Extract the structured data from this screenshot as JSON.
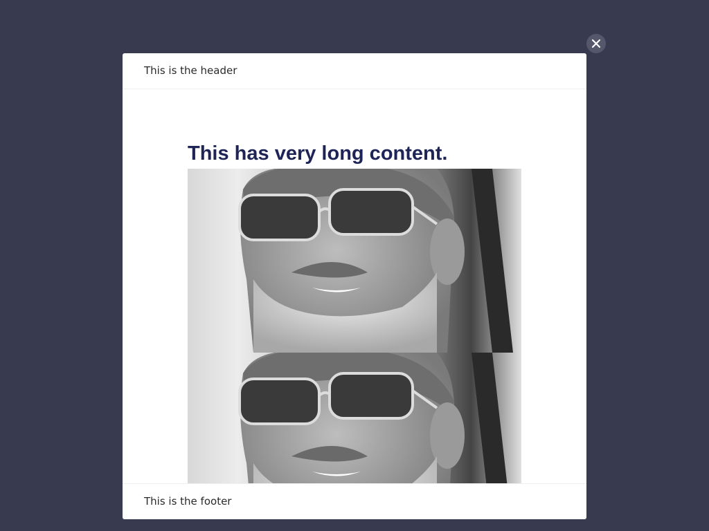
{
  "modal": {
    "header_text": "This is the header",
    "footer_text": "This is the footer",
    "content_title": "This has very long content.",
    "close_icon": "close-icon",
    "photos": [
      "portrait-photo",
      "portrait-photo"
    ]
  },
  "colors": {
    "backdrop": "#383a50",
    "modal_bg": "#ffffff",
    "title": "#1e2456",
    "close_button": "#55576a"
  }
}
